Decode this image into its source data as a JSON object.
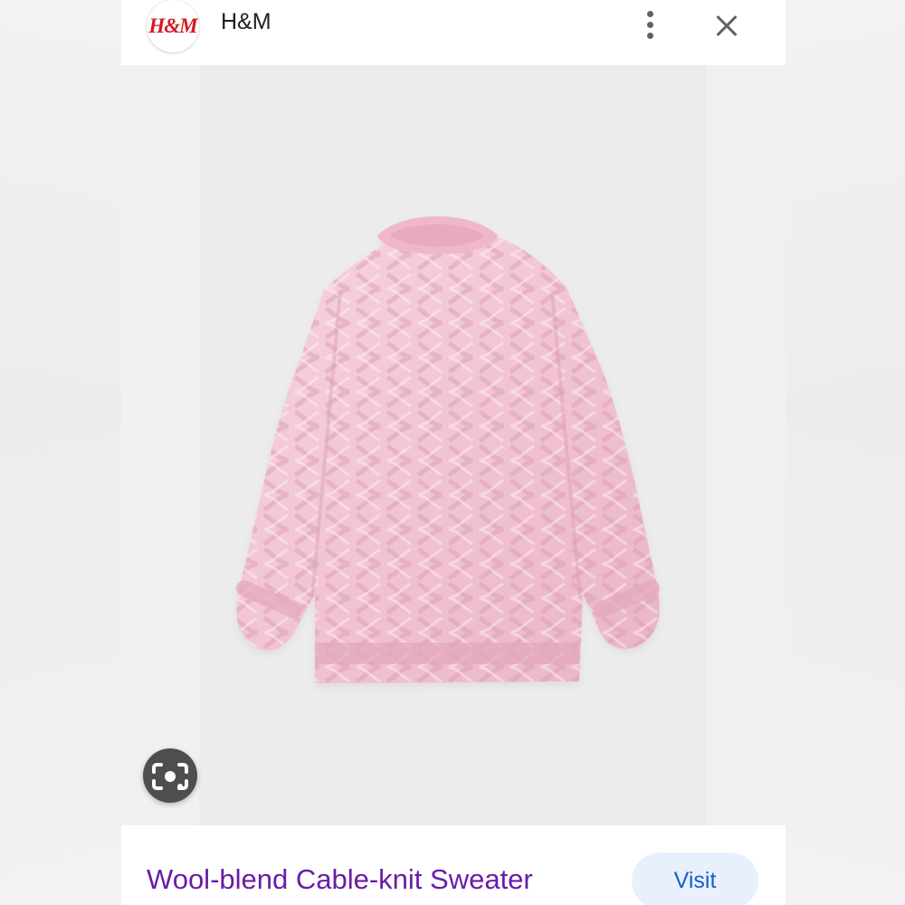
{
  "header": {
    "logo_text": "H&M",
    "title": "H&M",
    "more_icon": "more-vert-icon",
    "close_icon": "close-icon"
  },
  "product": {
    "image_subject": "pink cable-knit sweater",
    "title": "Wool-blend Cable-knit Sweater"
  },
  "actions": {
    "lens_icon": "lens-search-icon",
    "visit_label": "Visit"
  },
  "colors": {
    "brand_red": "#d71920",
    "title_purple": "#681da8",
    "visit_background": "#e8f0fe",
    "visit_text": "#1a5fc4",
    "sweater_pink": "#f2c8d6"
  }
}
